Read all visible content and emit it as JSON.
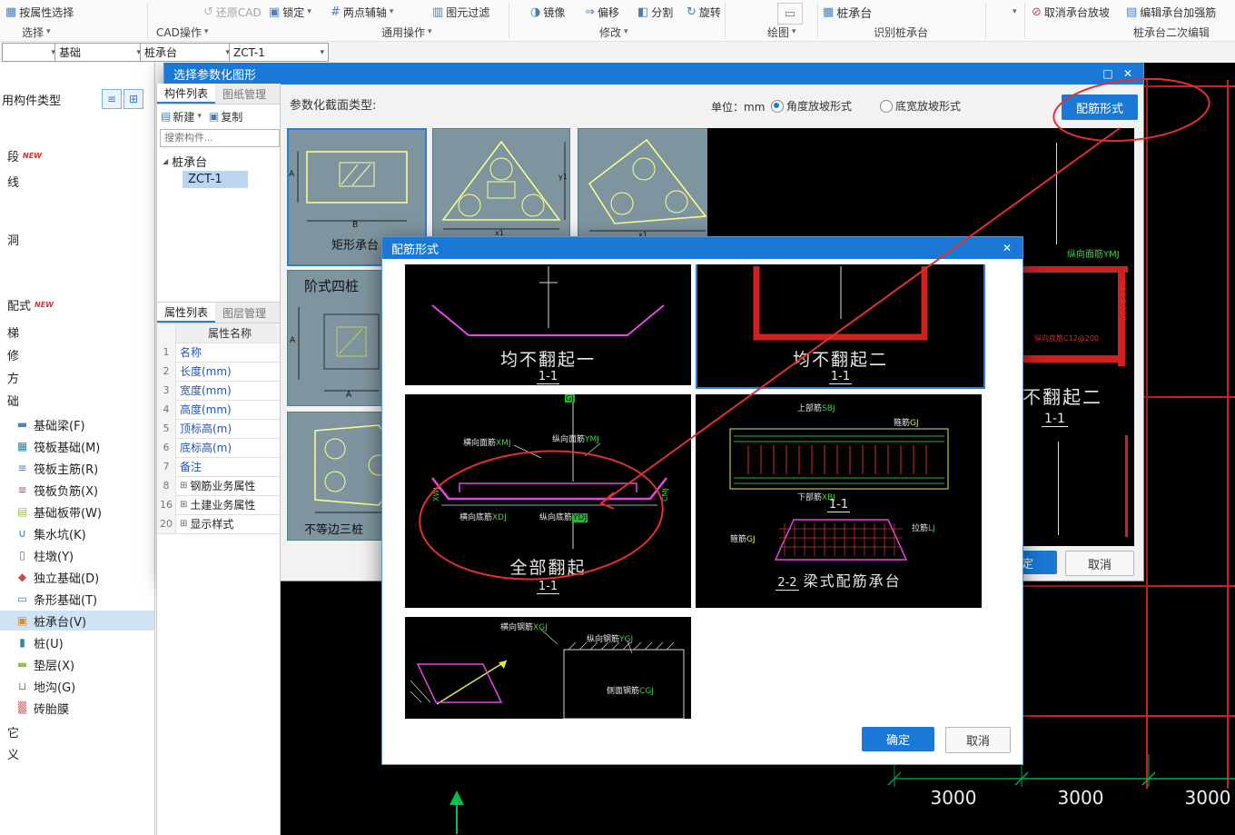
{
  "toolbar": {
    "row1": [
      {
        "label": "按属性选择"
      },
      {
        "label": "还原CAD"
      },
      {
        "label": "锁定"
      },
      {
        "label": "两点辅轴"
      },
      {
        "label": "图元过滤"
      },
      {
        "label": "镜像"
      },
      {
        "label": "偏移"
      },
      {
        "label": "分割"
      },
      {
        "label": "旋转"
      },
      {
        "label": "桩承台"
      },
      {
        "label": "取消承台放坡"
      },
      {
        "label": "编辑承台加强筋"
      }
    ],
    "groups": [
      "选择",
      "CAD操作",
      "通用操作",
      "修改",
      "绘图",
      "识别桩承台",
      "桩承台二次编辑"
    ],
    "combos": {
      "level": "",
      "category": "基础",
      "element": "桩承台",
      "component": "ZCT-1"
    }
  },
  "sidebar": {
    "header": "用构件类型",
    "items": [
      {
        "label": "段",
        "badge": "NEW"
      },
      {
        "label": "线",
        "badge": ""
      },
      {
        "label": "洞",
        "badge": ""
      },
      {
        "label": "配式",
        "badge": "NEW"
      },
      {
        "label": "梯",
        "badge": ""
      },
      {
        "label": "修",
        "badge": ""
      },
      {
        "label": "方",
        "badge": ""
      },
      {
        "label": "础",
        "badge": ""
      }
    ],
    "foundation": [
      {
        "label": "基础梁(F)"
      },
      {
        "label": "筏板基础(M)"
      },
      {
        "label": "筏板主筋(R)"
      },
      {
        "label": "筏板负筋(X)"
      },
      {
        "label": "基础板带(W)"
      },
      {
        "label": "集水坑(K)"
      },
      {
        "label": "柱墩(Y)"
      },
      {
        "label": "独立基础(D)"
      },
      {
        "label": "条形基础(T)"
      },
      {
        "label": "桩承台(V)"
      },
      {
        "label": "桩(U)"
      },
      {
        "label": "垫层(X)"
      },
      {
        "label": "地沟(G)"
      },
      {
        "label": "砖胎膜"
      }
    ],
    "tail": [
      {
        "label": "它"
      },
      {
        "label": "义"
      }
    ]
  },
  "component_panel": {
    "tabs": [
      "构件列表",
      "图纸管理"
    ],
    "new_btn": "新建",
    "copy_btn": "复制",
    "search_placeholder": "搜索构件...",
    "tree_group": "桩承台",
    "tree_item": "ZCT-1"
  },
  "property_panel": {
    "tabs": [
      "属性列表",
      "图层管理"
    ],
    "header": "属性名称",
    "rows": [
      {
        "no": "1",
        "name": "名称"
      },
      {
        "no": "2",
        "name": "长度(mm)"
      },
      {
        "no": "3",
        "name": "宽度(mm)"
      },
      {
        "no": "4",
        "name": "高度(mm)"
      },
      {
        "no": "5",
        "name": "顶标高(m)"
      },
      {
        "no": "6",
        "name": "底标高(m)"
      },
      {
        "no": "7",
        "name": "备注"
      },
      {
        "no": "8",
        "name": "钢筋业务属性"
      },
      {
        "no": "16",
        "name": "土建业务属性"
      },
      {
        "no": "20",
        "name": "显示样式"
      }
    ]
  },
  "dialog_param": {
    "title": "选择参数化图形",
    "section_label": "参数化截面类型:",
    "unit_label": "单位：",
    "unit_value": "mm",
    "radio1": "角度放坡形式",
    "radio2": "底宽放坡形式",
    "rebar_button": "配筋形式",
    "thumbs": {
      "rect_caption": "矩形承台",
      "step4_caption": "阶式四桩",
      "tri3_caption": "不等边三桩",
      "dimA": "A",
      "dimB": "B",
      "dimx1": "x1",
      "dimy1": "y1"
    },
    "preview": {
      "top_label": "纵向面筋YMJ",
      "spec": "C12@200",
      "bottom_label": "纵向底筋C12@200",
      "title": "均不翻起二",
      "sub": "1-1"
    },
    "ok": "确定",
    "cancel": "取消"
  },
  "dialog_rebar": {
    "title": "配筋形式",
    "cards": {
      "a1": {
        "title": "均不翻起一",
        "sub": "1-1"
      },
      "a2": {
        "title": "均不翻起二",
        "sub": "1-1"
      },
      "b1": {
        "title": "全部翻起",
        "sub": "1-1",
        "l1": "横向面筋",
        "c1": "XMJ",
        "l2": "纵向面筋",
        "c2": "YMJ",
        "l3": "横向底筋",
        "c3": "XDJ",
        "l4": "纵向底筋",
        "c4": "YDJ",
        "gj": "GJ",
        "xwj": "XWJ",
        "cmj": "CMJ"
      },
      "b2": {
        "name": "梁式配筋承台",
        "s1": "1-1",
        "s2": "2-2",
        "l1": "上部筋",
        "c1": "SBJ",
        "l2": "箍筋",
        "c2": "GJ",
        "l3": "下部筋",
        "c3": "XBJ",
        "l4": "拉筋",
        "c4": "LJ"
      },
      "c1": {
        "l1": "横向钢筋",
        "c1": "XGJ",
        "l2": "纵向钢筋",
        "c2": "YGJ",
        "l3": "侧面钢筋",
        "c3": "CGJ"
      }
    },
    "ok": "确定",
    "cancel": "取消"
  },
  "canvas": {
    "dims": [
      "3000",
      "3000",
      "3000"
    ]
  },
  "colors": {
    "accent": "#1a79d6",
    "thumb_bg": "#7e959f",
    "cad_red": "#d02020",
    "cad_green": "#00b050",
    "rebar_magenta": "#e545e5",
    "rebar_yellow": "#e8e840",
    "annotation_red": "#e23030"
  }
}
